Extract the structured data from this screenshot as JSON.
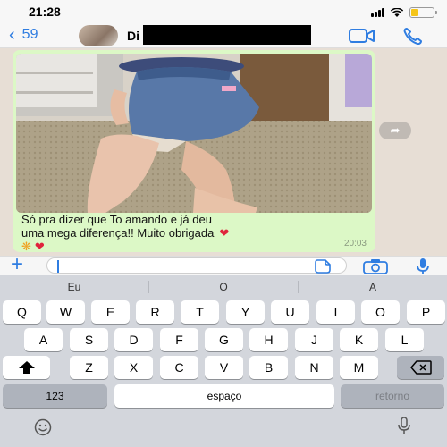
{
  "status": {
    "time": "21:28"
  },
  "nav": {
    "back_label": "59",
    "contact_name": "Di"
  },
  "message": {
    "text_line1": "Só pra dizer que To amando e já deu",
    "text_line2": "uma mega diferença!! Muito obrigada",
    "time": "20:03"
  },
  "suggestions": [
    "Eu",
    "O",
    "A"
  ],
  "keyboard": {
    "row1": [
      "Q",
      "W",
      "E",
      "R",
      "T",
      "Y",
      "U",
      "I",
      "O",
      "P"
    ],
    "row2": [
      "A",
      "S",
      "D",
      "F",
      "G",
      "H",
      "J",
      "K",
      "L"
    ],
    "row3": [
      "Z",
      "X",
      "C",
      "V",
      "B",
      "N",
      "M"
    ],
    "num_label": "123",
    "space_label": "espaço",
    "return_label": "retorno"
  },
  "colors": {
    "accent": "#2f7de1",
    "bubble": "#dcf8c6",
    "chat_bg": "#e7ded5",
    "battery": "#f5c518",
    "heart": "#e0233c"
  },
  "icons": [
    "back-chevron-icon",
    "video-call-icon",
    "phone-call-icon",
    "forward-icon",
    "plus-icon",
    "sticker-icon",
    "camera-icon",
    "microphone-icon",
    "shift-icon",
    "backspace-icon",
    "emoji-icon",
    "dictation-icon"
  ]
}
